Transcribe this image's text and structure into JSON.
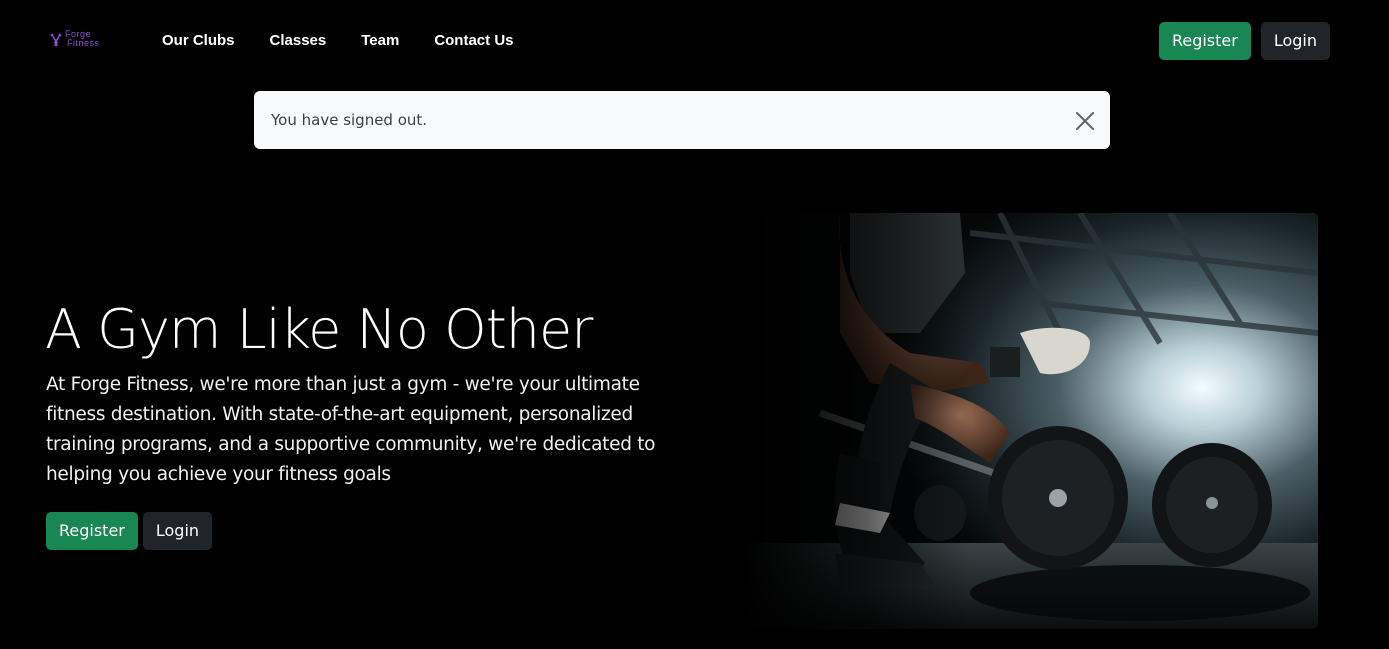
{
  "brand": {
    "name_line1": "Forge",
    "name_line2": "Fitness",
    "color": "#8f4fd6"
  },
  "nav": {
    "links": [
      "Our Clubs",
      "Classes",
      "Team",
      "Contact Us"
    ],
    "register_label": "Register",
    "login_label": "Login"
  },
  "alert": {
    "message": "You have signed out.",
    "close_icon": "close-icon"
  },
  "hero": {
    "title": "A Gym Like No Other",
    "description": "At Forge Fitness, we're more than just a gym - we're your ultimate fitness destination. With state-of-the-art equipment, personalized training programs, and a supportive community, we're dedicated to helping you achieve your fitness goals",
    "register_label": "Register",
    "login_label": "Login",
    "image_icon": "weightlifter-photo"
  },
  "colors": {
    "success": "#198754",
    "dark": "#212529",
    "alert_bg": "#f8f9fa"
  }
}
